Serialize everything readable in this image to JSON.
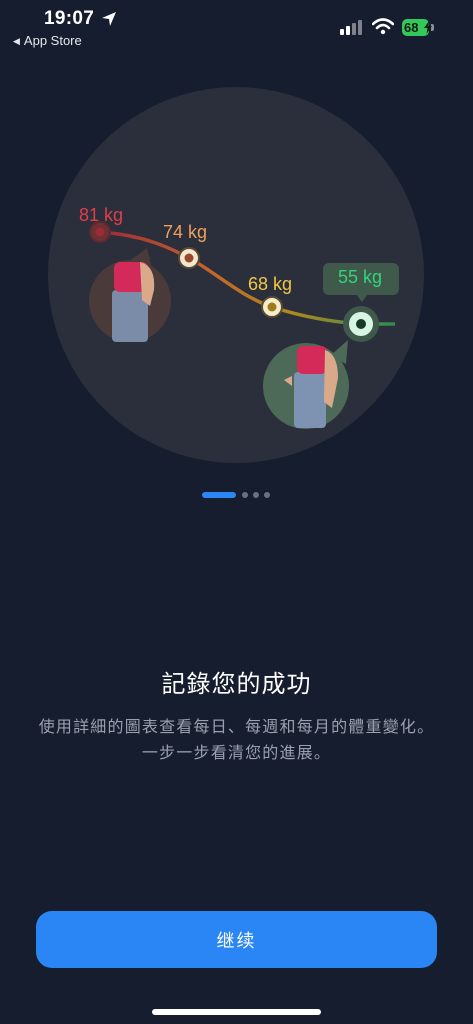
{
  "status_bar": {
    "time": "19:07",
    "back_label": "App Store",
    "battery_percent": "68",
    "icons": [
      "location-arrow-icon",
      "signal-icon",
      "wifi-icon",
      "battery-icon",
      "bolt-icon"
    ],
    "battery_color": "#34c759"
  },
  "chart_data": {
    "type": "line",
    "x": [
      1,
      2,
      3,
      4
    ],
    "values": [
      81,
      74,
      68,
      55
    ],
    "labels": [
      "81 kg",
      "74 kg",
      "68 kg",
      "55 kg"
    ],
    "label_colors": [
      "#e23d4b",
      "#f0a05a",
      "#f2c744",
      "#34d37a"
    ],
    "title": "",
    "xlabel": "",
    "ylabel": "",
    "grid": false
  },
  "pager": {
    "count": 4,
    "active_index": 0,
    "active_color": "#2a86f5"
  },
  "content": {
    "headline": "記錄您的成功",
    "description": "使用詳細的圖表查看每日、每週和每月的體重變化。一步一步看清您的進展。"
  },
  "actions": {
    "continue_label": "继续"
  },
  "colors": {
    "background": "#161d2e",
    "circle": "#2a2f3b",
    "accent": "#2a86f5"
  }
}
